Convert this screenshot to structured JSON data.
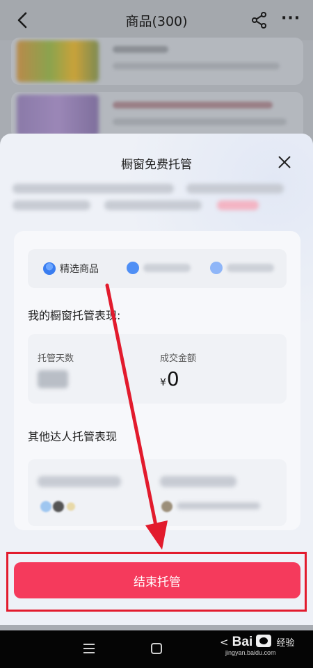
{
  "header": {
    "title": "商品(300)",
    "back_icon": "back-chevron-icon",
    "share_icon": "share-icon",
    "more_label": "···"
  },
  "modal": {
    "title": "橱窗免费托管",
    "close_icon": "close-icon",
    "tabs": [
      {
        "label": "精选商品",
        "icon": "person-icon"
      }
    ],
    "my_section": {
      "heading": "我的橱窗托管表现:",
      "metrics": [
        {
          "label": "托管天数",
          "value": ""
        },
        {
          "label": "成交金额",
          "currency": "¥",
          "value": "0"
        }
      ]
    },
    "others_heading": "其他达人托管表现"
  },
  "actions": {
    "end_label": "结束托管"
  },
  "watermark": {
    "brand": "Bai",
    "brand_suffix": "经验",
    "url": "jingyan.baidu.com"
  },
  "colors": {
    "primary_button": "#f53a5c",
    "highlight_box": "#e21b2d",
    "arrow": "#e21b2d"
  }
}
